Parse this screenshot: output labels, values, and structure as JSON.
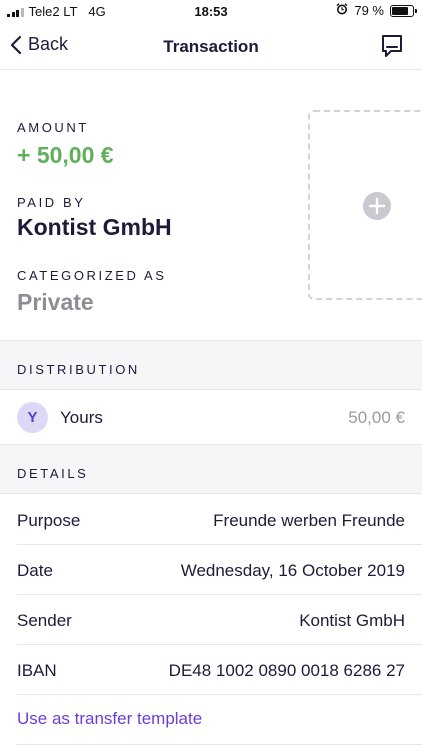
{
  "status_bar": {
    "carrier": "Tele2 LT",
    "network": "4G",
    "time": "18:53",
    "battery_percent": "79 %",
    "battery_level": 0.79,
    "alarm_icon": "alarm-clock-icon"
  },
  "nav": {
    "back_label": "Back",
    "title": "Transaction",
    "note_icon": "notes-icon"
  },
  "summary": {
    "amount_label": "AMOUNT",
    "amount_value": "+ 50,00 €",
    "paid_by_label": "PAID BY",
    "paid_by_value": "Kontist GmbH",
    "categorized_label": "CATEGORIZED AS",
    "categorized_value": "Private",
    "add_receipt_icon": "plus-circle-icon"
  },
  "distribution": {
    "header": "DISTRIBUTION",
    "avatar_letter": "Y",
    "name": "Yours",
    "amount": "50,00 €"
  },
  "details": {
    "header": "DETAILS",
    "rows": [
      {
        "key": "Purpose",
        "value": "Freunde werben Freunde"
      },
      {
        "key": "Date",
        "value": "Wednesday, 16 October 2019"
      },
      {
        "key": "Sender",
        "value": "Kontist GmbH"
      },
      {
        "key": "IBAN",
        "value": "DE48 1002 0890 0018 6286 27"
      }
    ]
  },
  "actions": {
    "template_link": "Use as transfer template"
  },
  "colors": {
    "amount_positive": "#5fb05a",
    "accent_purple": "#6a3fd4",
    "text_primary": "#1d1b3a",
    "text_muted": "#8d8d96"
  }
}
